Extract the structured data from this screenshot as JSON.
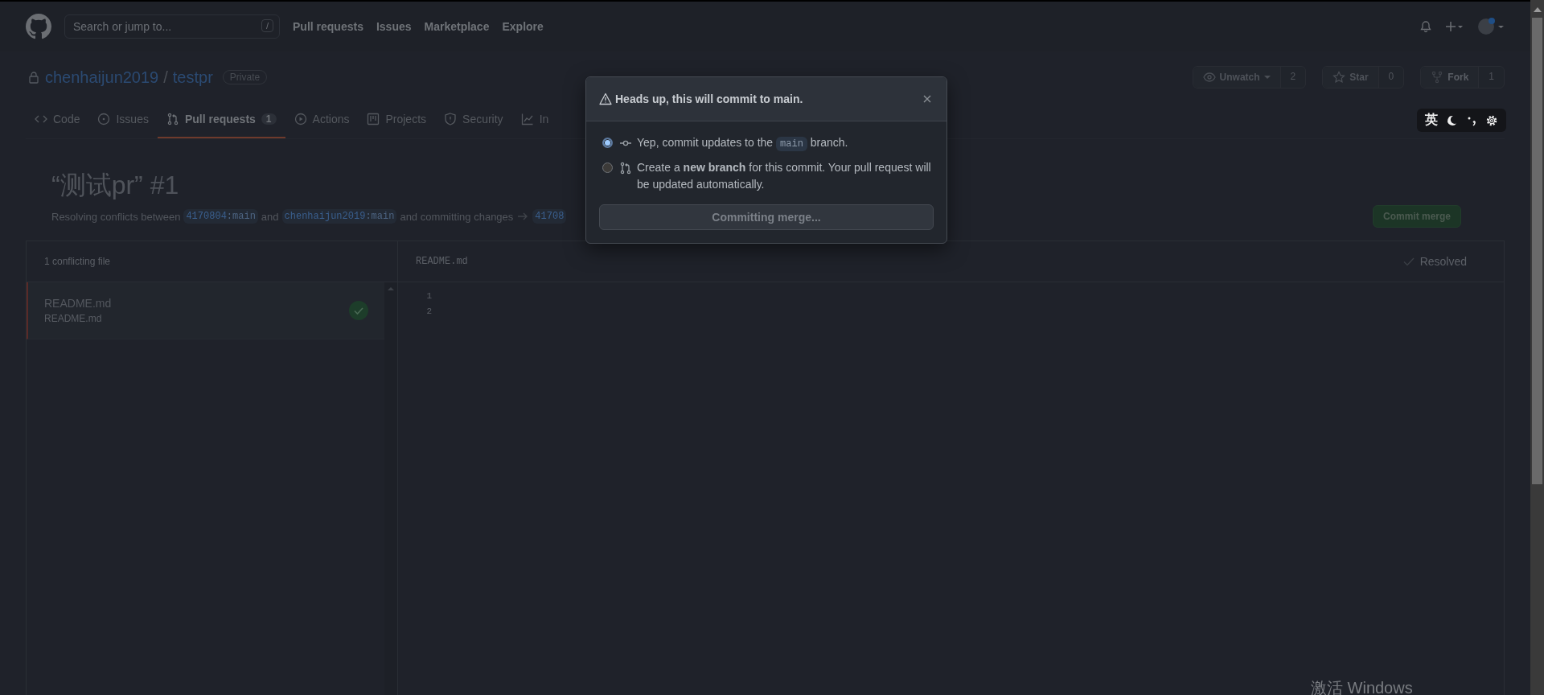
{
  "header": {
    "search": {
      "placeholder": "Search or jump to...",
      "shortcut": "/"
    },
    "nav": [
      "Pull requests",
      "Issues",
      "Marketplace",
      "Explore"
    ]
  },
  "repo": {
    "owner": "chenhaijun2019",
    "separator": "/",
    "name": "testpr",
    "visibility": "Private",
    "actions": [
      {
        "kind": "watch",
        "label": "Unwatch",
        "count": "2"
      },
      {
        "kind": "star",
        "label": "Star",
        "count": "0"
      },
      {
        "kind": "fork",
        "label": "Fork",
        "count": "1"
      }
    ]
  },
  "tabs": [
    {
      "kind": "code",
      "label": "Code",
      "selected": false
    },
    {
      "kind": "issues",
      "label": "Issues",
      "selected": false
    },
    {
      "kind": "pulls",
      "label": "Pull requests",
      "counter": "1",
      "selected": true
    },
    {
      "kind": "actions",
      "label": "Actions",
      "selected": false
    },
    {
      "kind": "projects",
      "label": "Projects",
      "selected": false
    },
    {
      "kind": "security",
      "label": "Security",
      "selected": false
    },
    {
      "kind": "insights",
      "label": "In",
      "selected": false
    }
  ],
  "ime_toolbar": {
    "language": "英"
  },
  "pull_request": {
    "title": "“测试pr”",
    "number": "#1",
    "lead": "Resolving conflicts between",
    "chips": [
      {
        "user": "4170804",
        "branch": ":main"
      },
      {
        "user": "chenhaijun2019",
        "branch": ":main"
      },
      {
        "user": "41708"
      }
    ],
    "joiner": "and",
    "trail": "and committing changes",
    "commit_button": "Commit merge"
  },
  "files": {
    "heading": "1 conflicting file",
    "items": [
      {
        "name": "README.md",
        "path": "README.md",
        "resolved": true
      }
    ]
  },
  "editor": {
    "filename": "README.md",
    "status": "Resolved",
    "line_numbers": [
      "1",
      "2"
    ]
  },
  "dialog": {
    "title": "Heads up, this will commit to main.",
    "options": [
      {
        "kind": "commit",
        "selected": true,
        "text_before": "Yep, commit updates to the",
        "code": "main",
        "text_after": "branch."
      },
      {
        "kind": "new_branch",
        "selected": false,
        "text": "Create a **new branch** for this commit. Your pull request will be updated automatically."
      }
    ],
    "button": "Committing merge..."
  },
  "os_watermark": "激活 Windows"
}
